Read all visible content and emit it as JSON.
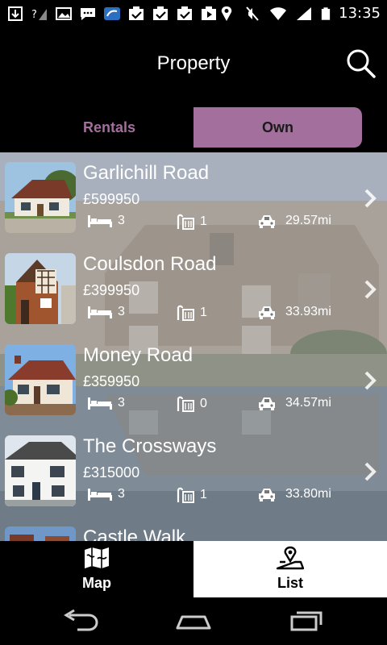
{
  "status_bar": {
    "time": "13:35"
  },
  "header": {
    "title": "Property"
  },
  "tabs": {
    "rentals_label": "Rentals",
    "own_label": "Own",
    "active": "Own"
  },
  "colors": {
    "accent": "#a36f9c",
    "background": "#000000",
    "active_nav_bg": "#ffffff"
  },
  "listings": [
    {
      "title": "Garlichill Road",
      "price": "£599950",
      "beds": "3",
      "baths": "1",
      "distance": "29.57mi"
    },
    {
      "title": "Coulsdon Road",
      "price": "£399950",
      "beds": "3",
      "baths": "1",
      "distance": "33.93mi"
    },
    {
      "title": "Money Road",
      "price": "£359950",
      "beds": "3",
      "baths": "0",
      "distance": "34.57mi"
    },
    {
      "title": "The Crossways",
      "price": "£315000",
      "beds": "3",
      "baths": "1",
      "distance": "33.80mi"
    },
    {
      "title": "Castle Walk"
    }
  ],
  "bottom_nav": {
    "map_label": "Map",
    "list_label": "List",
    "active": "List"
  }
}
